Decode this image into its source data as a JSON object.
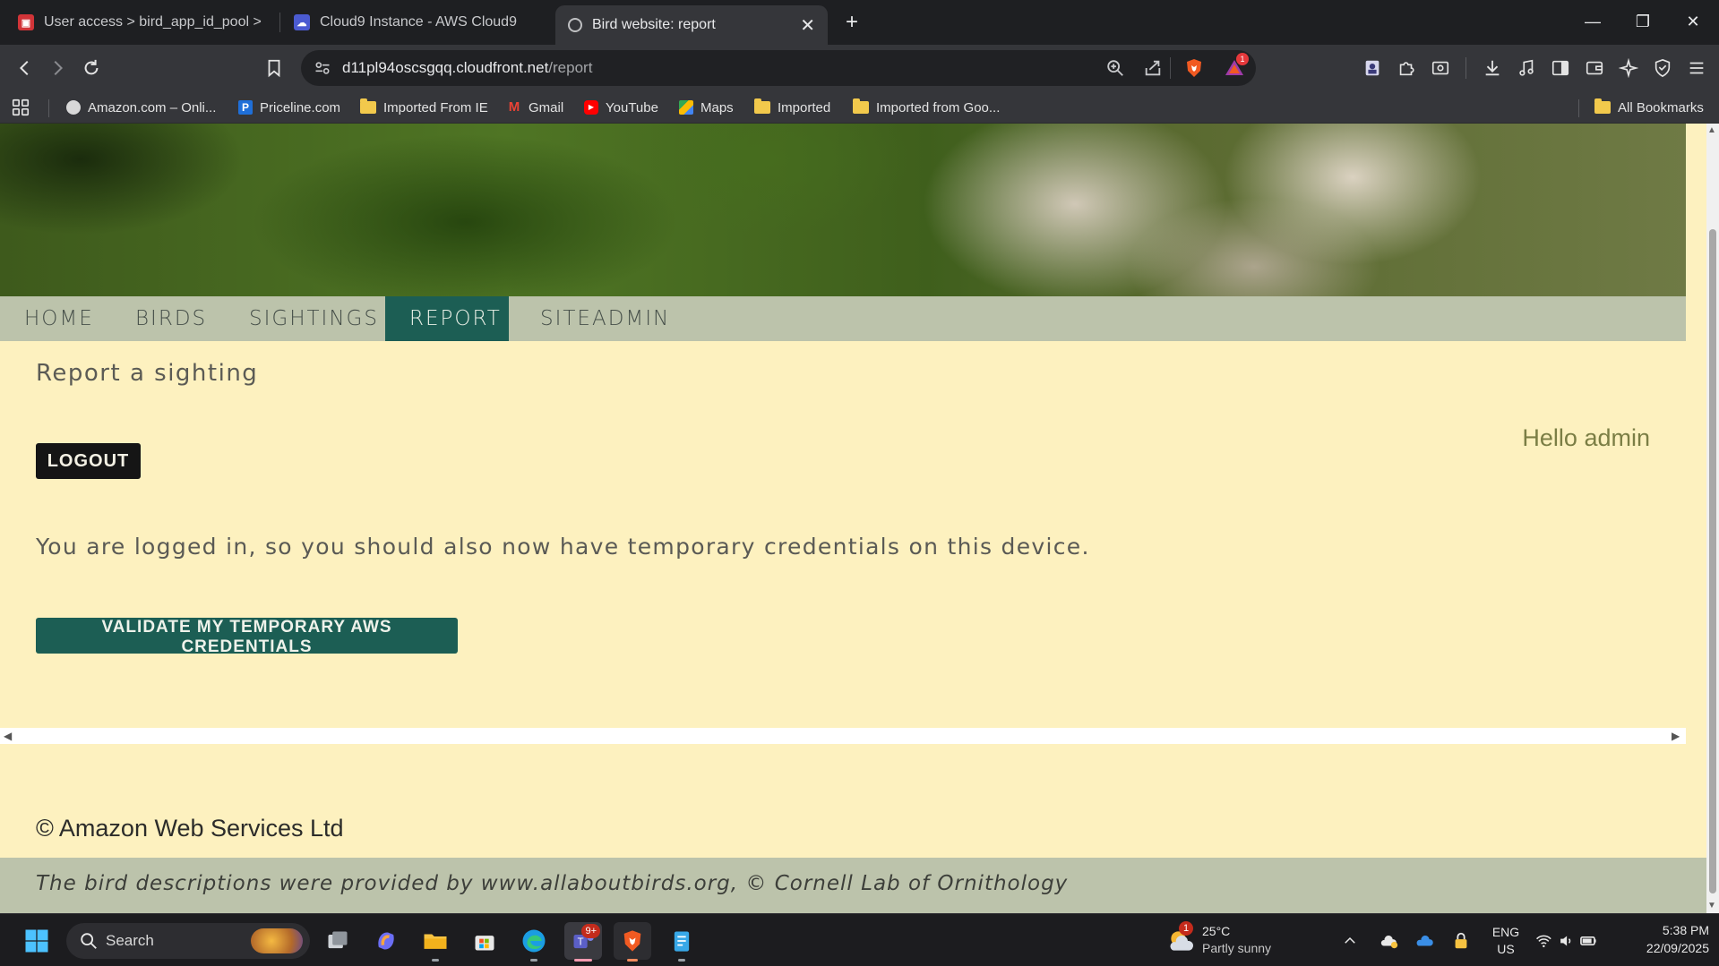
{
  "browser": {
    "tabs": [
      {
        "label": "User access > bird_app_id_pool > Ide",
        "icon": "aws-cognito-icon"
      },
      {
        "label": "Cloud9 Instance - AWS Cloud9",
        "icon": "cloud9-icon"
      },
      {
        "label": "Bird website: report",
        "icon": "globe-icon",
        "active": true
      }
    ],
    "close_glyph": "✕",
    "new_tab_glyph": "+",
    "url_host": "d11pl94oscsgqq.cloudfront.net",
    "url_path": "/report",
    "brave_badge": "1",
    "bookmarks": [
      {
        "label": "Amazon.com – Onli...",
        "icon": "amazon-icon"
      },
      {
        "label": "Priceline.com",
        "icon": "priceline-icon"
      },
      {
        "label": "Imported From IE",
        "icon": "folder-icon"
      },
      {
        "label": "Gmail",
        "icon": "gmail-icon"
      },
      {
        "label": "YouTube",
        "icon": "youtube-icon"
      },
      {
        "label": "Maps",
        "icon": "maps-icon"
      },
      {
        "label": "Imported",
        "icon": "folder-icon"
      },
      {
        "label": "Imported from Goo...",
        "icon": "folder-icon"
      }
    ],
    "all_bookmarks": "All Bookmarks"
  },
  "site": {
    "nav": [
      "HOME",
      "BIRDS",
      "SIGHTINGS",
      "REPORT",
      "SITEADMIN"
    ],
    "active_nav": "REPORT",
    "heading": "Report a sighting",
    "logout_label": "LOGOUT",
    "greeting": "Hello admin",
    "logged_in_message": "You are logged in, so you should also now have temporary credentials on this device.",
    "validate_label": "VALIDATE MY TEMPORARY AWS CREDENTIALS",
    "copyright": "© Amazon Web Services Ltd",
    "attribution": "The bird descriptions were provided by www.allaboutbirds.org, © Cornell Lab of Ornithology"
  },
  "taskbar": {
    "search_placeholder": "Search",
    "teams_badge": "9+",
    "weather_temp": "25°C",
    "weather_desc": "Partly sunny",
    "weather_badge": "1",
    "lang_line1": "ENG",
    "lang_line2": "US",
    "time": "5:38 PM",
    "date": "22/09/2025"
  },
  "colors": {
    "nav_active": "#1c5e54",
    "page_bg": "#fdf1bf",
    "nav_bg": "#bcc3ab"
  }
}
